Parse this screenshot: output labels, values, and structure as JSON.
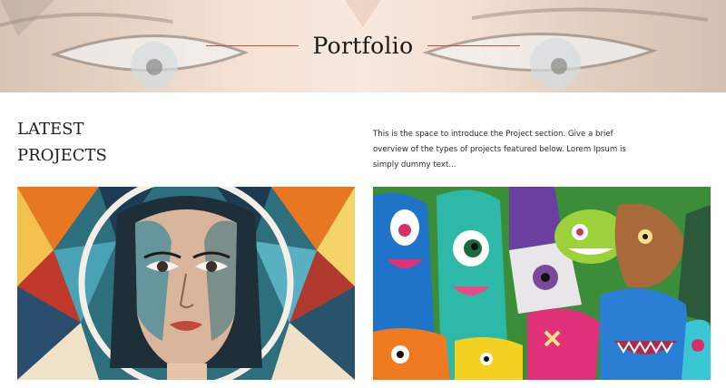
{
  "hero": {
    "title": "Portfolio"
  },
  "intro": {
    "heading_line1": "LATEST",
    "heading_line2": "PROJECTS",
    "description": "This is the space to introduce the Project section. Give a brief overview of the types of projects featured below. Lorem Ipsum is simply dummy text..."
  },
  "projects": [
    {
      "image": "street-art-portrait-mural"
    },
    {
      "image": "colorful-monster-graffiti-mural"
    }
  ],
  "colors": {
    "accent_line": "#b8533a",
    "text": "#1a1a1a",
    "background": "#ffffff"
  }
}
